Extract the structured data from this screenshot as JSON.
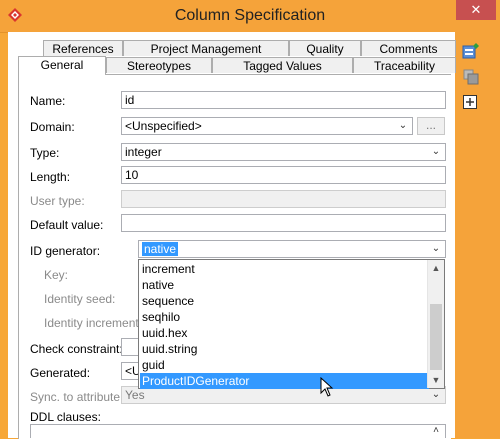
{
  "window": {
    "title": "Column Specification",
    "close_glyph": "✕"
  },
  "tabs_row1": [
    "References",
    "Project Management",
    "Quality",
    "Comments"
  ],
  "tabs_row2": [
    "General",
    "Stereotypes",
    "Tagged Values",
    "Traceability"
  ],
  "form": {
    "name_label": "Name:",
    "name_value": "id",
    "domain_label": "Domain:",
    "domain_value": "<Unspecified>",
    "domain_more": "...",
    "type_label": "Type:",
    "type_value": "integer",
    "length_label": "Length:",
    "length_value": "10",
    "user_type_label": "User type:",
    "user_type_value": "",
    "default_value_label": "Default value:",
    "default_value_value": "",
    "id_generator_label": "ID generator:",
    "id_generator_value": "native",
    "key_label": "Key:",
    "identity_seed_label": "Identity seed:",
    "identity_increment_label": "Identity increment:",
    "check_constraint_label": "Check constraint:",
    "generated_label": "Generated:",
    "generated_value": "<U",
    "sync_label": "Sync. to attribute:",
    "sync_value": "Yes",
    "ddl_label": "DDL clauses:"
  },
  "dropdown": {
    "options": [
      "increment",
      "native",
      "sequence",
      "seqhilo",
      "uuid.hex",
      "uuid.string",
      "guid",
      "ProductIDGenerator"
    ],
    "highlighted": "ProductIDGenerator"
  },
  "icons": {
    "app": "visual-paradigm-logo-icon",
    "side_tools": [
      "add-model-icon",
      "stack-icon",
      "expand-icon"
    ]
  },
  "colors": {
    "accent": "#f5a33a",
    "selection": "#3399ff",
    "close": "#c75050"
  }
}
